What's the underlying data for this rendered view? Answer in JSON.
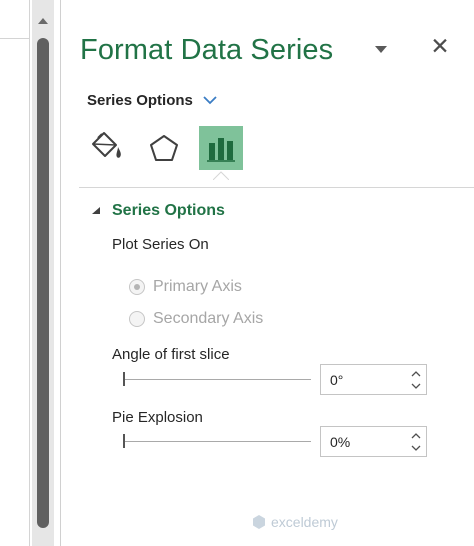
{
  "pane": {
    "title": "Format Data Series",
    "series_options_label": "Series Options"
  },
  "tabs": [
    {
      "name": "Fill & Line",
      "icon": "paint-bucket-icon"
    },
    {
      "name": "Effects",
      "icon": "pentagon-icon"
    },
    {
      "name": "Series Options",
      "icon": "bar-chart-icon",
      "active": true
    }
  ],
  "section": {
    "header": "Series Options",
    "plot_series_on_label": "Plot Series On",
    "primary_axis_label": "Primary Axis",
    "secondary_axis_label": "Secondary Axis",
    "primary_axis_selected": true,
    "axis_options_enabled": false
  },
  "angle": {
    "label": "Angle of first slice",
    "value": "0°",
    "slider_fraction": 0
  },
  "explosion": {
    "label": "Pie Explosion",
    "value": "0%",
    "slider_fraction": 0
  },
  "watermark": {
    "text": "exceldemy"
  },
  "colors": {
    "accent": "#217346",
    "active_tab": "#7fc29a",
    "disabled_text": "#a6a6a6"
  }
}
